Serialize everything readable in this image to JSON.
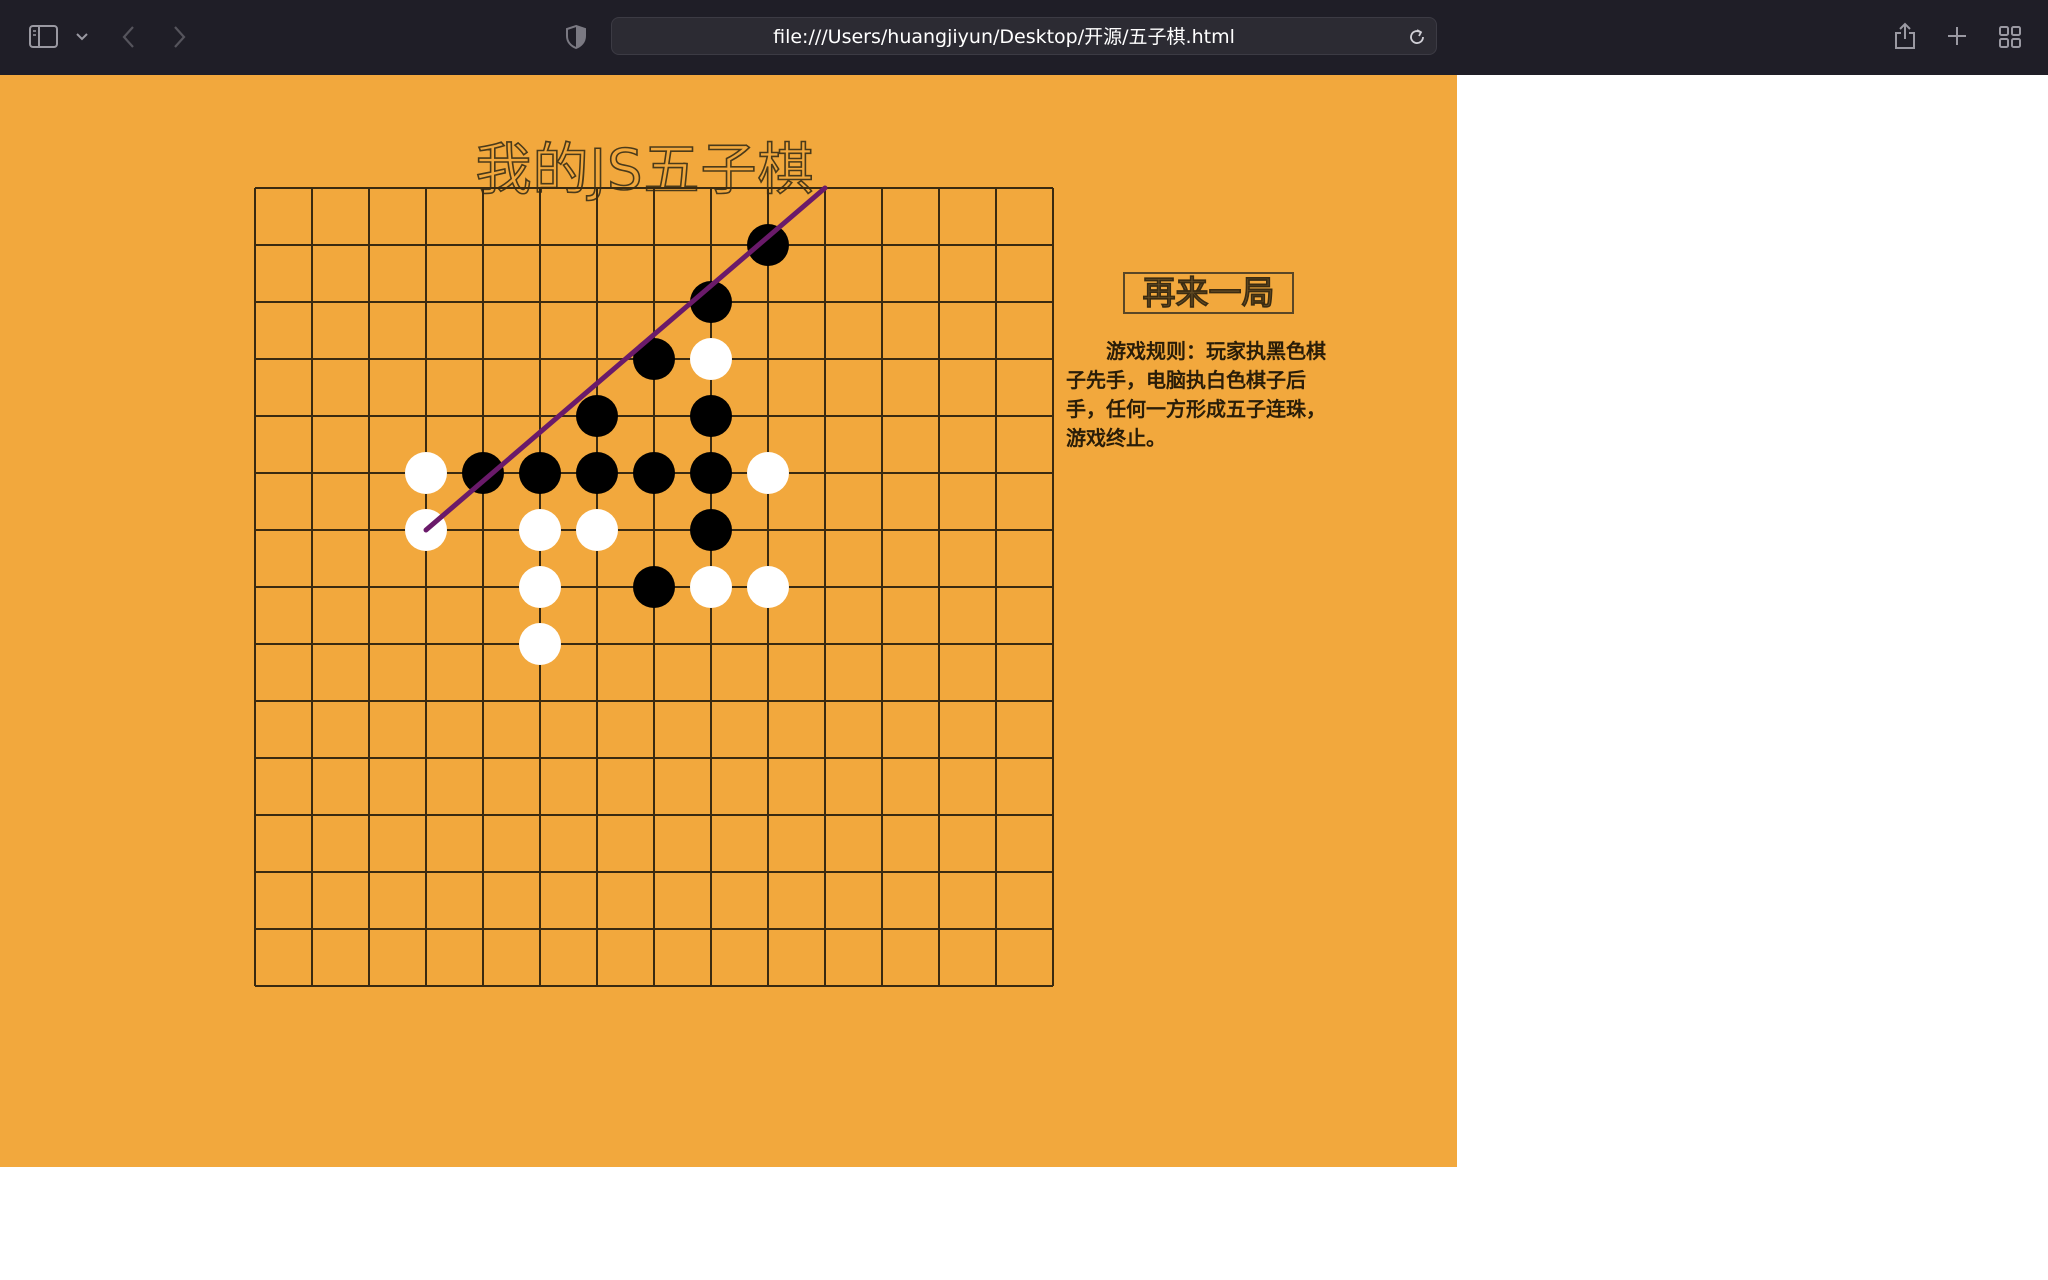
{
  "browser": {
    "url": "file:///Users/huangjiyun/Desktop/开源/五子棋.html",
    "icons": [
      "sidebar-icon",
      "chevron-down-icon",
      "back-icon",
      "forward-icon",
      "privacy-shield-icon",
      "reload-icon",
      "share-icon",
      "new-tab-icon",
      "tab-overview-icon"
    ]
  },
  "game": {
    "title": "我的JS五子棋",
    "restart_label": "再来一局",
    "rules": "游戏规则：玩家执黑色棋子先手，电脑执白色棋子后手，任何一方形成五子连珠，游戏终止。",
    "board_size": 15,
    "colors": {
      "background": "#f2a83d",
      "grid": "#3a2a10",
      "black": "#000000",
      "white": "#ffffff",
      "win_line": "#6a1a6a"
    },
    "black_stones": [
      [
        9,
        1
      ],
      [
        8,
        2
      ],
      [
        7,
        3
      ],
      [
        8,
        4
      ],
      [
        6,
        4
      ],
      [
        5,
        5
      ],
      [
        6,
        5
      ],
      [
        7,
        5
      ],
      [
        8,
        5
      ],
      [
        4,
        5
      ],
      [
        8,
        6
      ],
      [
        7,
        7
      ]
    ],
    "white_stones": [
      [
        8,
        3
      ],
      [
        3,
        5
      ],
      [
        9,
        5
      ],
      [
        3,
        6
      ],
      [
        5,
        6
      ],
      [
        6,
        6
      ],
      [
        5,
        7
      ],
      [
        8,
        7
      ],
      [
        9,
        7
      ],
      [
        5,
        8
      ]
    ],
    "winning_line": {
      "from": [
        3,
        6
      ],
      "to": [
        10,
        0
      ]
    }
  }
}
